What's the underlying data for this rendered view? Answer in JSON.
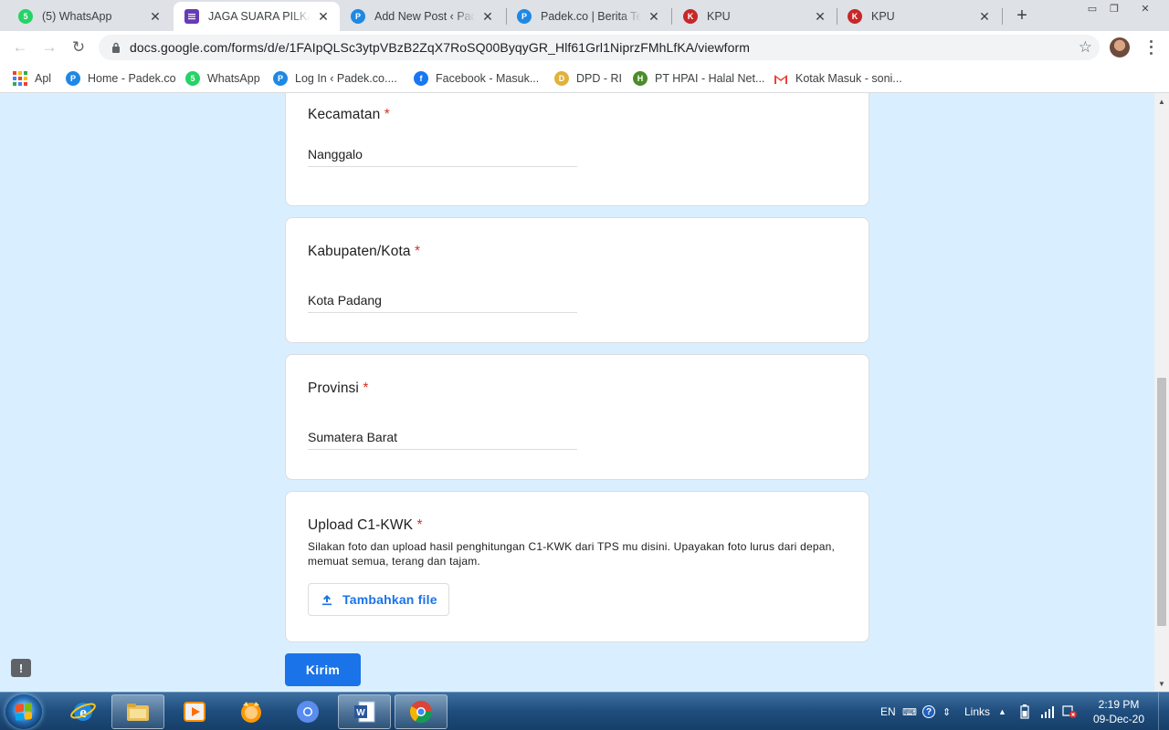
{
  "browser": {
    "tabs": [
      {
        "title": "(5) WhatsApp",
        "active": false,
        "favicon": "whatsapp-icon",
        "badge": "5"
      },
      {
        "title": "JAGA SUARA PILKADA",
        "active": true,
        "favicon": "google-forms-icon"
      },
      {
        "title": "Add New Post ‹ Padek",
        "active": false,
        "favicon": "padek-icon"
      },
      {
        "title": "Padek.co | Berita Terbaru",
        "active": false,
        "favicon": "padek-icon"
      },
      {
        "title": "KPU",
        "active": false,
        "favicon": "kpu-icon"
      },
      {
        "title": "KPU",
        "active": false,
        "favicon": "kpu-icon"
      }
    ],
    "url": "docs.google.com/forms/d/e/1FAIpQLSc3ytpVBzB2ZqX7RoSQ00ByqyGR_Hlf61Grl1NiprzFMhLfKA/viewform",
    "bookmarks": [
      {
        "label": "Apl",
        "icon": "apps-grid-icon"
      },
      {
        "label": "Home - Padek.co",
        "icon": "padek-icon"
      },
      {
        "label": "WhatsApp",
        "icon": "whatsapp-icon"
      },
      {
        "label": "Log In ‹ Padek.co....",
        "icon": "padek-icon"
      },
      {
        "label": "Facebook - Masuk...",
        "icon": "facebook-icon"
      },
      {
        "label": "DPD - RI",
        "icon": "dpd-icon"
      },
      {
        "label": "PT HPAI - Halal Net...",
        "icon": "hpai-icon"
      },
      {
        "label": "Kotak Masuk - soni...",
        "icon": "gmail-icon"
      }
    ]
  },
  "form": {
    "questions": [
      {
        "title": "Kecamatan",
        "required_mark": "*",
        "answer": "Nanggalo"
      },
      {
        "title": "Kabupaten/Kota",
        "required_mark": "*",
        "answer": "Kota Padang"
      },
      {
        "title": "Provinsi",
        "required_mark": "*",
        "answer": "Sumatera Barat"
      }
    ],
    "upload": {
      "title": "Upload C1-KWK",
      "required_mark": "*",
      "help": "Silakan foto dan upload hasil penghitungan C1-KWK dari TPS mu disini. Upayakan foto lurus dari depan, memuat semua, terang dan tajam.",
      "button_label": "Tambahkan file"
    },
    "submit_label": "Kirim",
    "feedback_icon": "!"
  },
  "taskbar": {
    "items": [
      "start-button",
      "internet-explorer-icon",
      "file-explorer-icon",
      "media-player-icon",
      "messenger-icon",
      "chrome-icon",
      "word-icon",
      "chrome-active-icon"
    ],
    "language": "EN",
    "links_label": "Links",
    "time": "2:19 PM",
    "date": "09-Dec-20"
  },
  "colors": {
    "page_background": "#d9efff",
    "accent": "#1a73e8",
    "required": "#d93025"
  }
}
